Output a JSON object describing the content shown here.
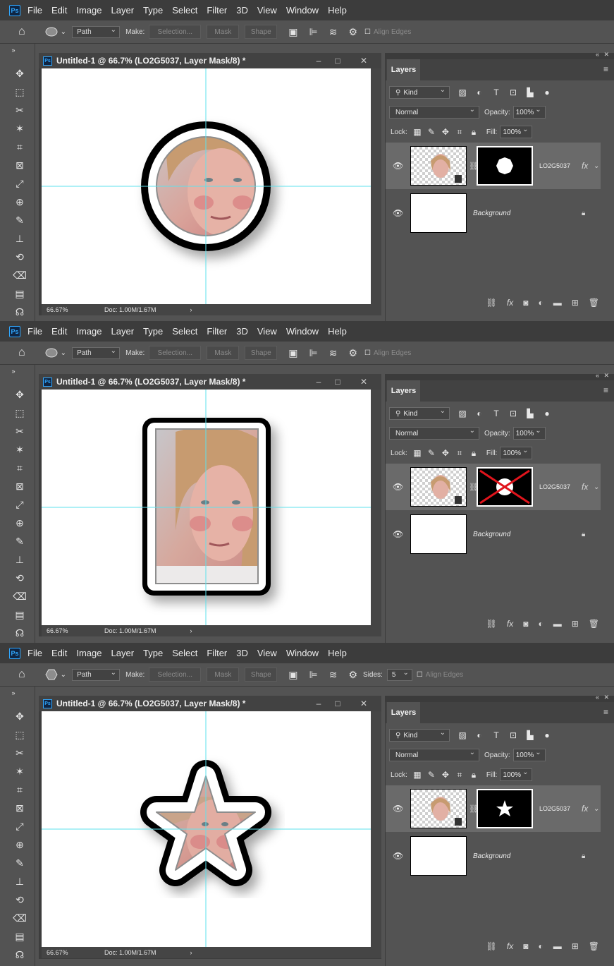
{
  "app": {
    "menu": [
      "File",
      "Edit",
      "Image",
      "Layer",
      "Type",
      "Select",
      "Filter",
      "3D",
      "View",
      "Window",
      "Help"
    ],
    "logo_text": "Ps"
  },
  "panels": [
    {
      "options": {
        "tool_icon": "ellipse-tool-icon",
        "path_mode": "Path",
        "make_label": "Make:",
        "selection_btn": "Selection...",
        "mask_btn": "Mask",
        "shape_btn": "Shape",
        "sides_label": "",
        "sides_value": "",
        "align_edges": "Align Edges"
      },
      "doc": {
        "title": "Untitled-1 @ 66.7% (LO2G5037, Layer Mask/8) *",
        "zoom": "66.67%",
        "doc_info": "Doc: 1.00M/1.67M"
      },
      "layers": {
        "tab": "Layers",
        "kind": "Kind",
        "blend": "Normal",
        "opacity_label": "Opacity:",
        "opacity": "100%",
        "lock_label": "Lock:",
        "fill_label": "Fill:",
        "fill": "100%",
        "layer_name": "LO2G5037",
        "fx": "fx",
        "background": "Background",
        "mask_shape": "circle"
      }
    },
    {
      "options": {
        "tool_icon": "ellipse-tool-icon",
        "path_mode": "Path",
        "make_label": "Make:",
        "selection_btn": "Selection...",
        "mask_btn": "Mask",
        "shape_btn": "Shape",
        "sides_label": "",
        "sides_value": "",
        "align_edges": "Align Edges"
      },
      "doc": {
        "title": "Untitled-1 @ 66.7% (LO2G5037, Layer Mask/8) *",
        "zoom": "66.67%",
        "doc_info": "Doc: 1.00M/1.67M"
      },
      "layers": {
        "tab": "Layers",
        "kind": "Kind",
        "blend": "Normal",
        "opacity_label": "Opacity:",
        "opacity": "100%",
        "lock_label": "Lock:",
        "fill_label": "Fill:",
        "fill": "100%",
        "layer_name": "LO2G5037",
        "fx": "fx",
        "background": "Background",
        "mask_shape": "disabled-circle"
      }
    },
    {
      "options": {
        "tool_icon": "polygon-tool-icon",
        "path_mode": "Path",
        "make_label": "Make:",
        "selection_btn": "Selection...",
        "mask_btn": "Mask",
        "shape_btn": "Shape",
        "sides_label": "Sides:",
        "sides_value": "5",
        "align_edges": "Align Edges"
      },
      "doc": {
        "title": "Untitled-1 @ 66.7% (LO2G5037, Layer Mask/8) *",
        "zoom": "66.67%",
        "doc_info": "Doc: 1.00M/1.67M"
      },
      "layers": {
        "tab": "Layers",
        "kind": "Kind",
        "blend": "Normal",
        "opacity_label": "Opacity:",
        "opacity": "100%",
        "lock_label": "Lock:",
        "fill_label": "Fill:",
        "fill": "100%",
        "layer_name": "LO2G5037",
        "fx": "fx",
        "background": "Background",
        "mask_shape": "star"
      }
    }
  ],
  "colors": {
    "guide": "#5ee1ec",
    "accent": "#31a8ff",
    "mask_cross": "#e0141c"
  }
}
